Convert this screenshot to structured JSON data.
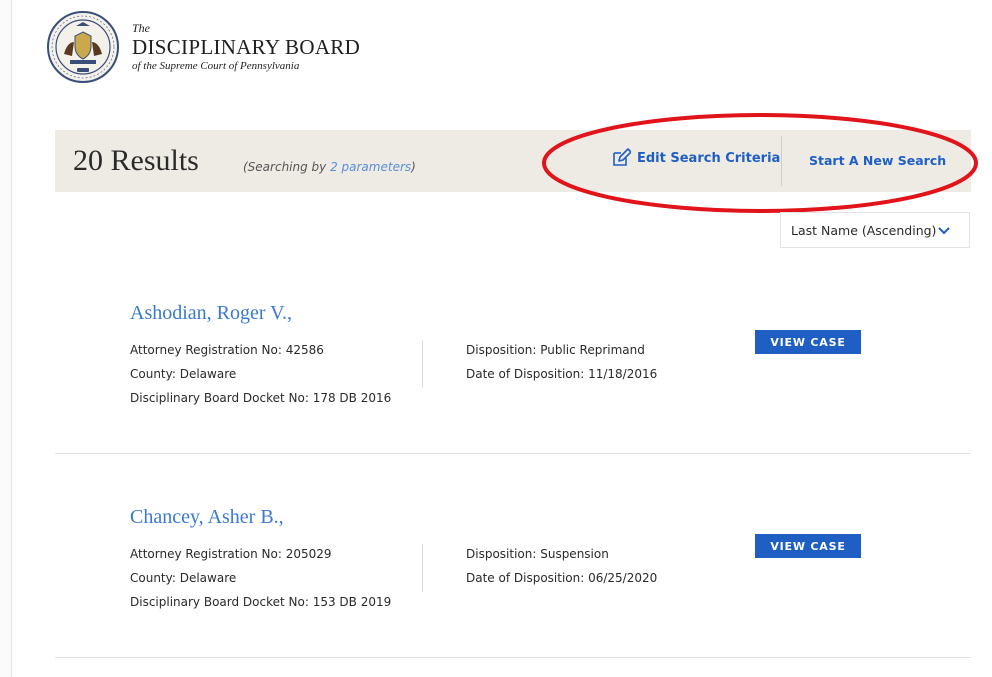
{
  "header": {
    "the": "The",
    "name": "DISCIPLINARY BOARD",
    "subtitle": "of the Supreme Court of Pennsylvania",
    "seal_icon": "pennsylvania-seal-icon"
  },
  "results_bar": {
    "count_text": "20 Results",
    "params_prefix": "(Searching by ",
    "params_link": "2 parameters",
    "params_suffix": ")",
    "edit_label": "Edit Search Criteria",
    "new_search_label": "Start A New Search"
  },
  "sort": {
    "selected": "Last Name (Ascending)"
  },
  "results": [
    {
      "name": "Ashodian, Roger V.,",
      "registration": "Attorney Registration No: 42586",
      "county": "County: Delaware",
      "docket": "Disciplinary Board Docket No: 178 DB 2016",
      "disposition": "Disposition: Public Reprimand",
      "date": "Date of Disposition: 11/18/2016",
      "button": "VIEW CASE"
    },
    {
      "name": "Chancey, Asher B.,",
      "registration": "Attorney Registration No: 205029",
      "county": "County: Delaware",
      "docket": "Disciplinary Board Docket No: 153 DB 2019",
      "disposition": "Disposition: Suspension",
      "date": "Date of Disposition: 06/25/2020",
      "button": "VIEW CASE"
    }
  ],
  "colors": {
    "accent": "#1f5fc4",
    "link": "#3b78d0",
    "bar_bg": "#eeebe4",
    "annotation": "#e0141a"
  }
}
